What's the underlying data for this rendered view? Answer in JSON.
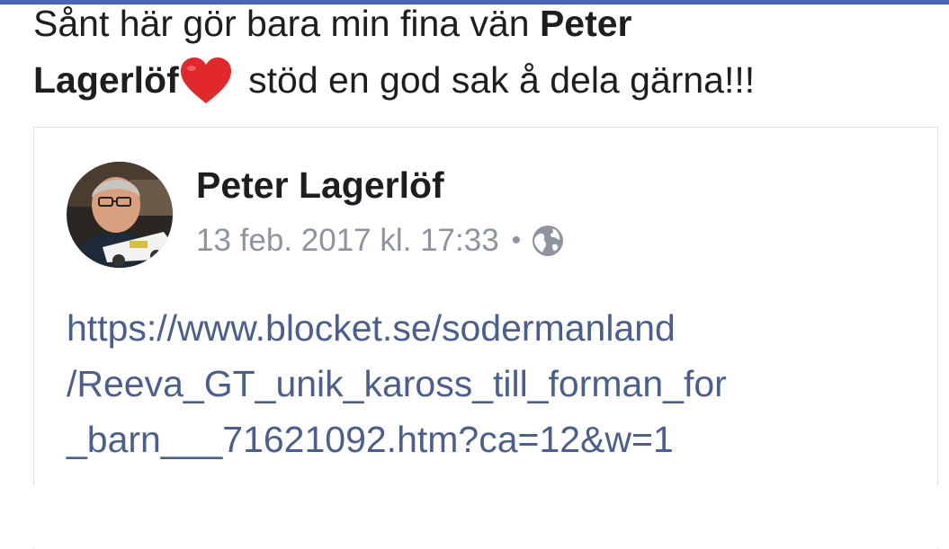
{
  "post": {
    "text_part1": "Sånt här gör bara min fina vän ",
    "text_name_line1": "Peter",
    "text_name_line2": "Lagerlöf",
    "text_part2": " stöd en god sak å dela gärna!!!"
  },
  "shared": {
    "author_name": "Peter Lagerlöf",
    "timestamp": "13 feb. 2017 kl. 17:33",
    "separator": "•",
    "privacy_icon": "globe-icon",
    "link_lines": [
      "https://www.blocket.se/sodermanland",
      "/Reeva_GT_unik_kaross_till_forman_for",
      "_barn___71621092.htm?ca=12&w=1"
    ]
  },
  "colors": {
    "accent_bar": "#4a67ad",
    "link": "#4b5f8f",
    "meta": "#8d949e",
    "heart": "#e0282d"
  }
}
